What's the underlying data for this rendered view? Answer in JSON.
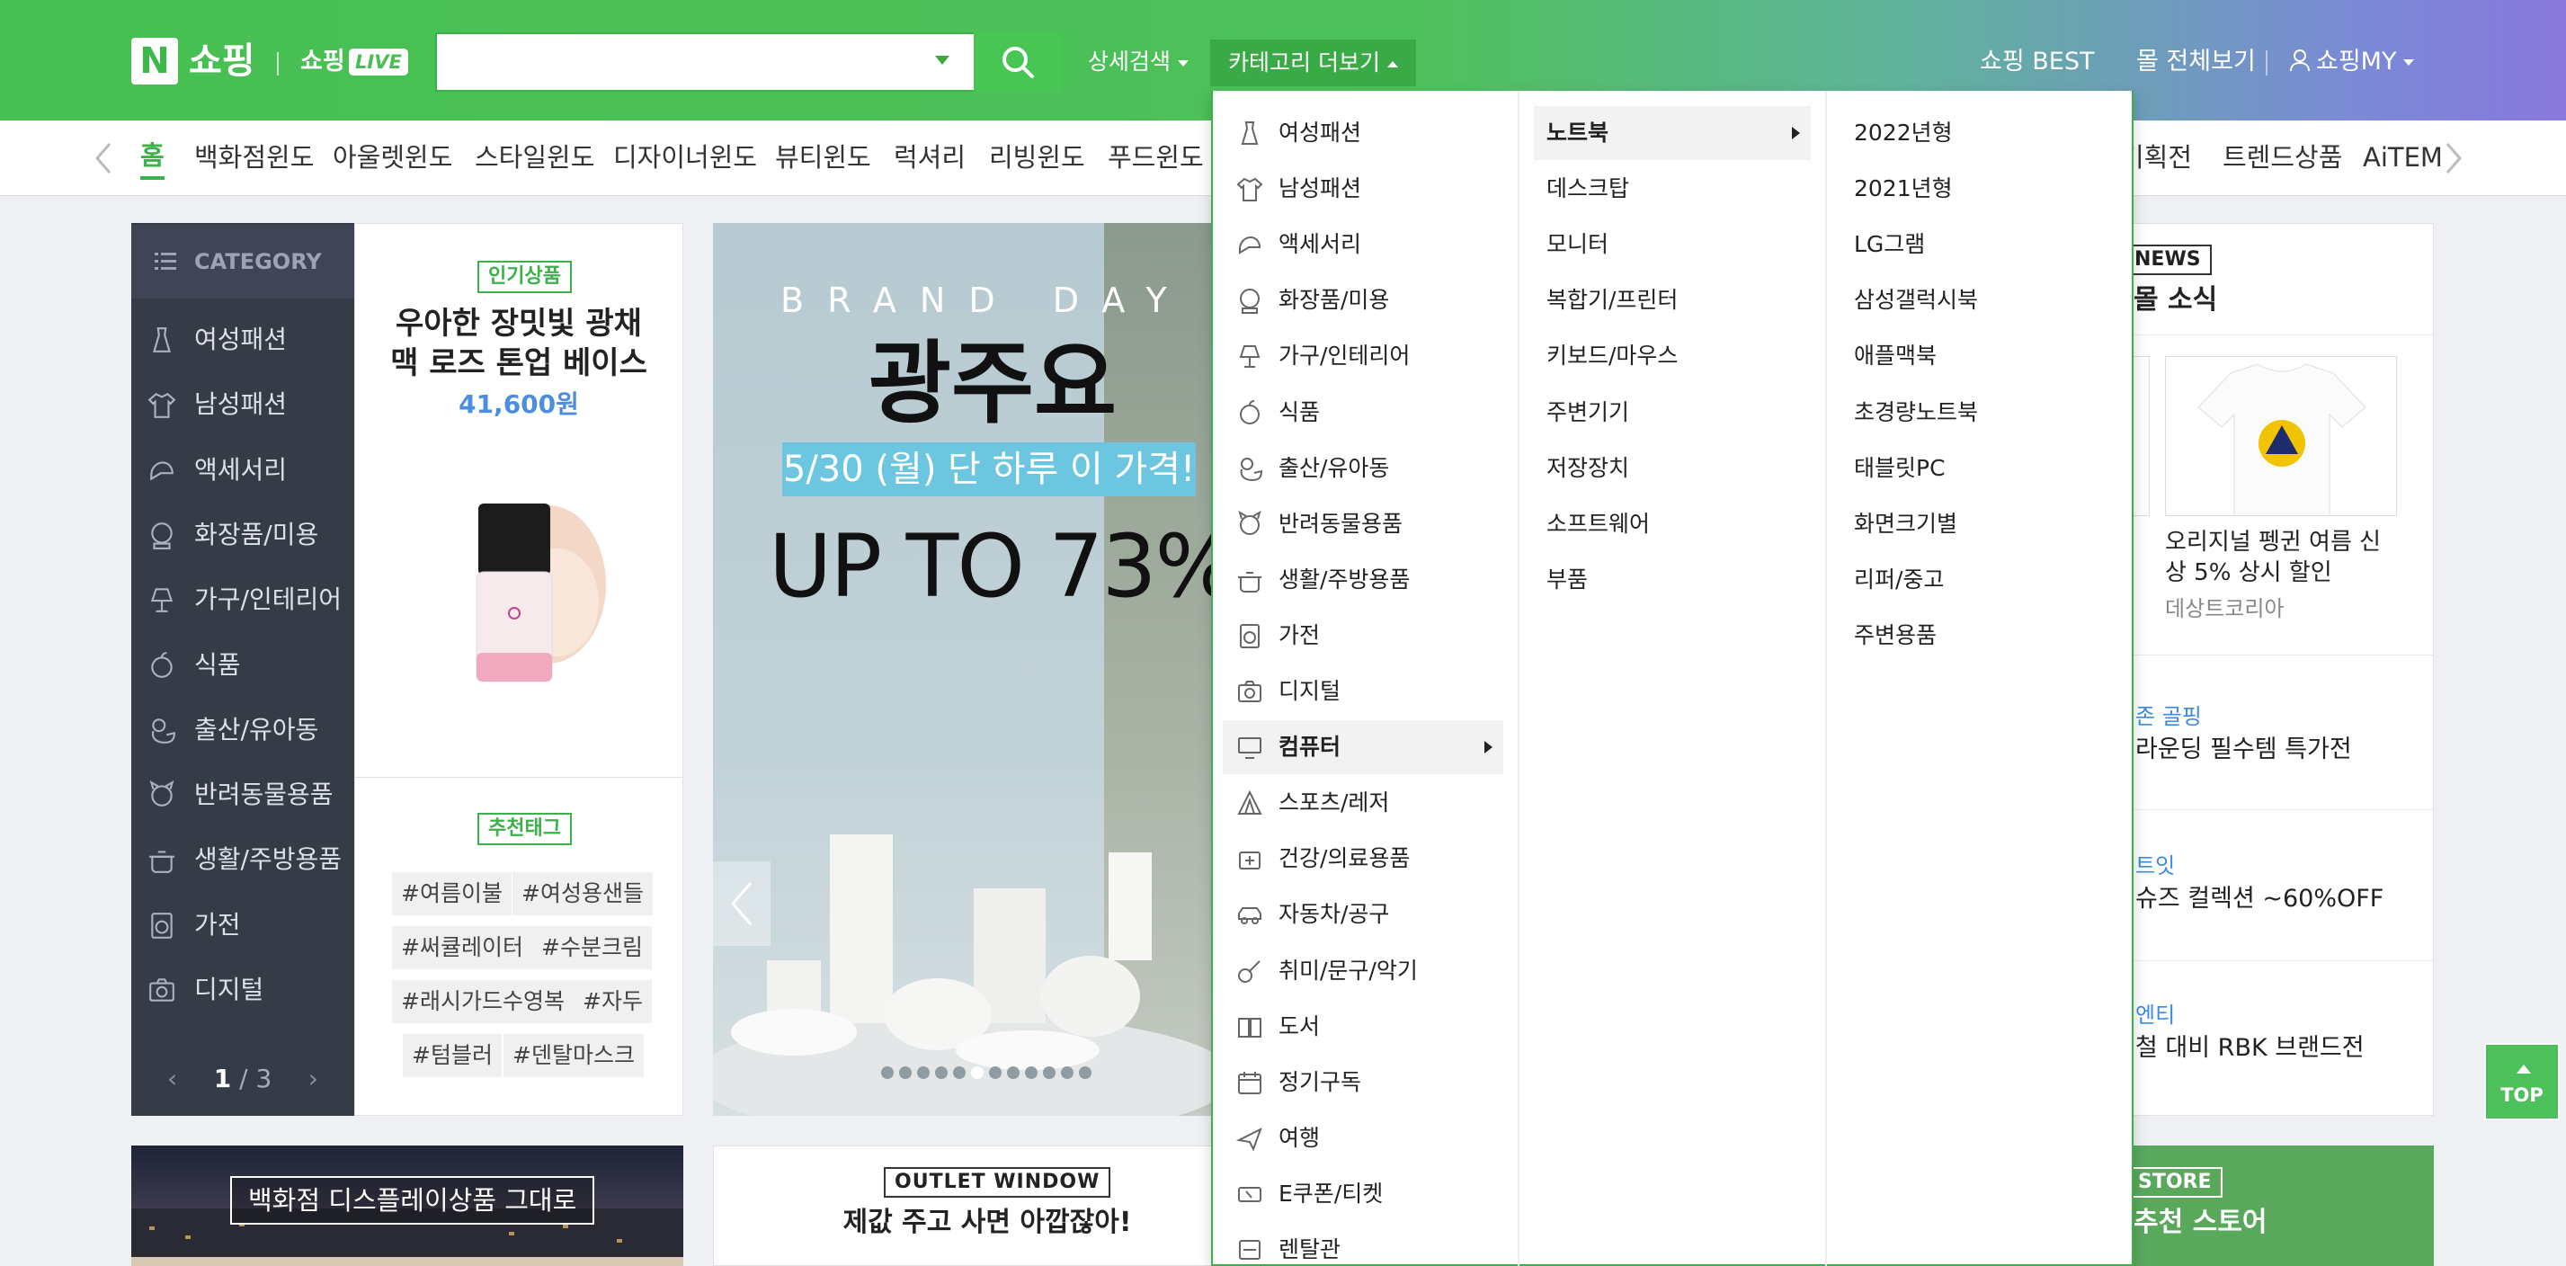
{
  "header": {
    "logo_n": "N",
    "logo_text": "쇼핑",
    "live_text": "쇼핑",
    "live_badge": "LIVE",
    "search_value": "",
    "detail_search": "상세검색",
    "category_more": "카테고리 더보기",
    "best": "쇼핑 BEST",
    "all_malls": "몰 전체보기",
    "my": "쇼핑MY",
    "colors": {
      "brand_green": "#3bb14a",
      "header_end": "#8a78dc"
    }
  },
  "nav": {
    "items": [
      "홈",
      "백화점윈도",
      "아울렛윈도",
      "스타일윈도",
      "디자이너윈도",
      "뷰티윈도",
      "럭셔리",
      "리빙윈도",
      "푸드윈도",
      "기획전",
      "트렌드상품",
      "AiTEM"
    ]
  },
  "category": {
    "head": "CATEGORY",
    "items": [
      "여성패션",
      "남성패션",
      "액세서리",
      "화장품/미용",
      "가구/인테리어",
      "식품",
      "출산/유아동",
      "반려동물용품",
      "생활/주방용품",
      "가전",
      "디지털"
    ],
    "icons": [
      "dress-icon",
      "shirt-icon",
      "cap-icon",
      "cosmetics-icon",
      "lamp-icon",
      "apple-icon",
      "duck-icon",
      "pet-icon",
      "pot-icon",
      "washer-icon",
      "camera-icon"
    ],
    "page_current": "1",
    "page_total": "/ 3"
  },
  "product": {
    "badge": "인기상품",
    "title_line1": "우아한 장밋빛 광채",
    "title_line2": "맥 로즈 톤업 베이스",
    "price": "41,600원",
    "tag_badge": "추천태그",
    "hashtags": [
      "#여름이불",
      "#여성용샌들",
      "#써큘레이터",
      "#수분크림",
      "#래시가드수영복",
      "#자두",
      "#텀블러",
      "#덴탈마스크"
    ]
  },
  "banner": {
    "brand_day": "BRAND DAY",
    "brand": "광주요",
    "date_text": "5/30 (월) 단 하루 이 가격!",
    "discount": "UP TO 73%",
    "dots_total": 12,
    "dots_active": 5
  },
  "dropdown": {
    "level1": [
      "여성패션",
      "남성패션",
      "액세서리",
      "화장품/미용",
      "가구/인테리어",
      "식품",
      "출산/유아동",
      "반려동물용품",
      "생활/주방용품",
      "가전",
      "디지털",
      "컴퓨터",
      "스포츠/레저",
      "건강/의료용품",
      "자동차/공구",
      "취미/문구/악기",
      "도서",
      "정기구독",
      "여행",
      "E쿠폰/티켓",
      "렌탈관"
    ],
    "level1_selected": "컴퓨터",
    "level2": [
      "노트북",
      "데스크탑",
      "모니터",
      "복합기/프린터",
      "키보드/마우스",
      "주변기기",
      "저장장치",
      "소프트웨어",
      "부품"
    ],
    "level2_selected": "노트북",
    "level3": [
      "2022년형",
      "2021년형",
      "LG그램",
      "삼성갤럭시북",
      "애플맥북",
      "초경량노트북",
      "태블릿PC",
      "화면크기별",
      "리퍼/중고",
      "주변용품"
    ]
  },
  "news": {
    "tag": "NEWS",
    "title": "몰 소식",
    "item_title_line1": "오리지널 펭귄 여름 신",
    "item_title_line2": "상 5% 상시 할인",
    "item_source": "데상트코리아",
    "links": [
      {
        "mall": "존 골핑",
        "desc": "라운딩 필수템 특가전"
      },
      {
        "mall": "트잇",
        "desc": "슈즈 컬렉션 ~60%OFF"
      },
      {
        "mall": "엔티",
        "desc": "철 대비 RBK 브랜드전"
      }
    ]
  },
  "top_button": "TOP",
  "bottom": {
    "dept_label": "백화점 디스플레이상품 그대로",
    "outlet_tag": "OUTLET WINDOW",
    "outlet_title": "제값 주고 사면 아깝잖아!",
    "store_tag": "STORE",
    "store_title": "추천 스토어"
  }
}
